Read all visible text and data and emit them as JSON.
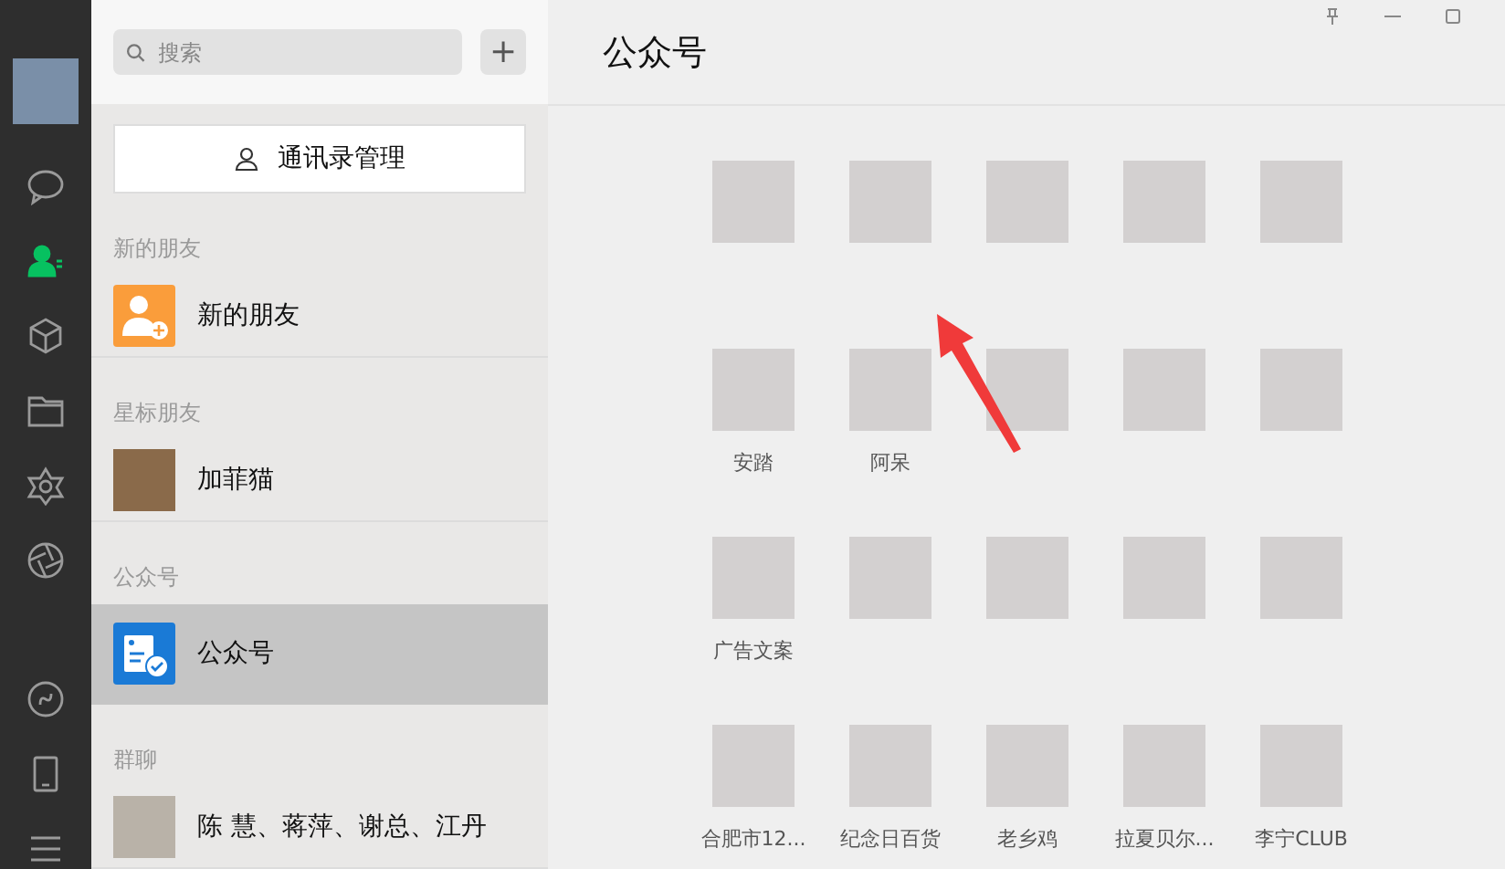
{
  "nav": [
    {
      "kind": "chat",
      "selected": false
    },
    {
      "kind": "contacts",
      "selected": true
    },
    {
      "kind": "cube",
      "selected": false
    },
    {
      "kind": "folder",
      "selected": false
    },
    {
      "kind": "star",
      "selected": false
    },
    {
      "kind": "aperture",
      "selected": false
    },
    {
      "kind": "link",
      "selected": false
    },
    {
      "kind": "phone",
      "selected": false
    },
    {
      "kind": "menu",
      "selected": false
    }
  ],
  "search": {
    "placeholder": "搜索",
    "add": "+"
  },
  "manage_button": "通讯录管理",
  "sections": [
    {
      "header": "新的朋友",
      "items": [
        {
          "name": "新的朋友",
          "kind": "new-friend",
          "selected": false
        }
      ]
    },
    {
      "header": "星标朋友",
      "items": [
        {
          "name": "加菲猫",
          "kind": "photo",
          "selected": false
        }
      ]
    },
    {
      "header": "公众号",
      "items": [
        {
          "name": "公众号",
          "kind": "official",
          "selected": true
        }
      ]
    },
    {
      "header": "群聊",
      "items": [
        {
          "name": "陈 慧、蒋萍、谢总、江丹",
          "kind": "group",
          "selected": false
        }
      ]
    }
  ],
  "main": {
    "title": "公众号"
  },
  "accounts": [
    {
      "kind": "unlabeled"
    },
    {
      "kind": "unlabeled"
    },
    {
      "kind": "unlabeled"
    },
    {
      "kind": "unlabeled"
    },
    {
      "kind": "unlabeled"
    },
    {
      "kind": "labeled",
      "name": "安踏"
    },
    {
      "kind": "labeled",
      "name": "阿呆"
    },
    {
      "kind": "unlabeled"
    },
    {
      "kind": "unlabeled"
    },
    {
      "kind": "unlabeled"
    },
    {
      "kind": "labeled",
      "name": "广告文案"
    },
    {
      "kind": "unlabeled"
    },
    {
      "kind": "unlabeled"
    },
    {
      "kind": "unlabeled"
    },
    {
      "kind": "unlabeled"
    },
    {
      "kind": "labeled",
      "name": "合肥市12..."
    },
    {
      "kind": "labeled",
      "name": "纪念日百货"
    },
    {
      "kind": "labeled",
      "name": "老乡鸡"
    },
    {
      "kind": "labeled",
      "name": "拉夏贝尔..."
    },
    {
      "kind": "labeled",
      "name": "李宁CLUB"
    }
  ]
}
